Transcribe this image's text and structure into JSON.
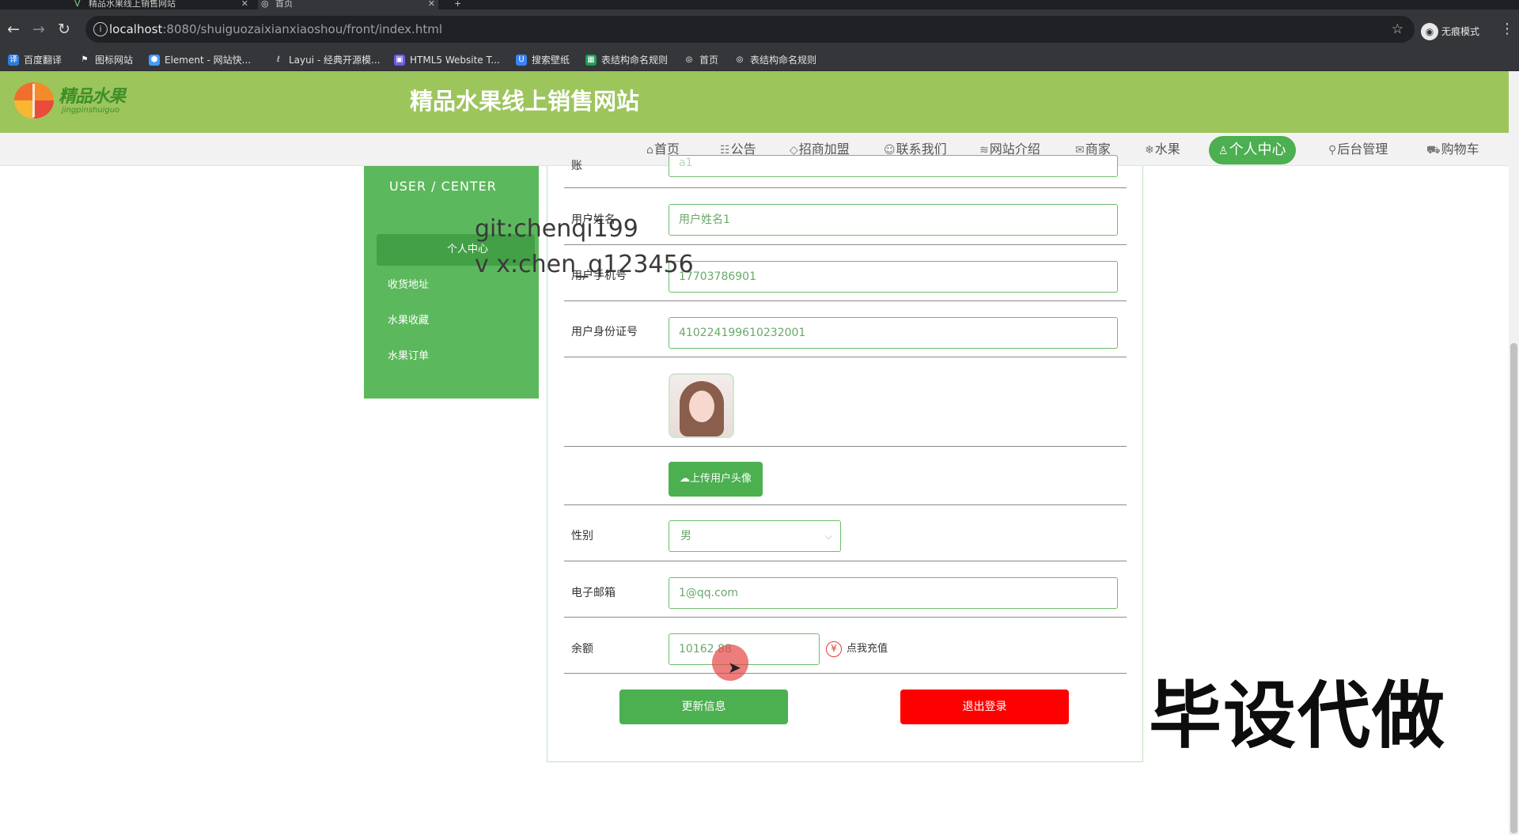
{
  "browser": {
    "tabs": [
      {
        "title": "精品水果线上销售网站",
        "active": false
      },
      {
        "title": "首页",
        "active": true
      }
    ],
    "new_tab_symbol": "+",
    "url_host": "localhost",
    "url_rest": ":8080/shuiguozaixianxiaoshou/front/index.html",
    "incognito_label": "无痕模式",
    "bookmarks": [
      "百度翻译",
      "图标网站",
      "Element - 网站快...",
      "Layui - 经典开源模...",
      "HTML5 Website T...",
      "搜索壁纸",
      "表结构命名规则",
      "首页",
      "表结构命名规则"
    ]
  },
  "site": {
    "logo_text": "精品水果",
    "logo_subtext": "jingpinshuiguo",
    "title": "精品水果线上销售网站",
    "nav": [
      {
        "label": "首页",
        "icon": "home-icon",
        "glyph": "⌂"
      },
      {
        "label": "公告",
        "icon": "notice-icon",
        "glyph": "☷"
      },
      {
        "label": "招商加盟",
        "icon": "tag-icon",
        "glyph": "◇"
      },
      {
        "label": "联系我们",
        "icon": "contact-icon",
        "glyph": "☺"
      },
      {
        "label": "网站介绍",
        "icon": "book-icon",
        "glyph": "≋"
      },
      {
        "label": "商家",
        "icon": "mail-icon",
        "glyph": "✉"
      },
      {
        "label": "水果",
        "icon": "snowflake-icon",
        "glyph": "❄"
      },
      {
        "label": "个人中心",
        "icon": "user-icon",
        "glyph": "♙",
        "active": true
      },
      {
        "label": "后台管理",
        "icon": "link-icon",
        "glyph": "⚲"
      },
      {
        "label": "购物车",
        "icon": "cart-icon",
        "glyph": "⛟"
      }
    ]
  },
  "sidebar": {
    "heading": "USER / CENTER",
    "items": [
      {
        "label": "个人中心",
        "active": true
      },
      {
        "label": "收货地址"
      },
      {
        "label": "水果收藏"
      },
      {
        "label": "水果订单"
      }
    ]
  },
  "form": {
    "top_cut_label": "账",
    "top_cut_value": "a1",
    "name_label": "用户姓名",
    "name_value": "用户姓名1",
    "phone_label": "用户手机号",
    "phone_value": "17703786901",
    "idcard_label": "用户身份证号",
    "idcard_value": "410224199610232001",
    "upload_label": "上传用户头像",
    "gender_label": "性别",
    "gender_value": "男",
    "email_label": "电子邮箱",
    "email_value": "1@qq.com",
    "balance_label": "余额",
    "balance_value": "10162.88",
    "recharge_label": "点我充值",
    "update_label": "更新信息",
    "logout_label": "退出登录"
  },
  "watermarks": {
    "git": "git:chenqi199",
    "vx": "v x:chen_q123456",
    "big": "毕设代做"
  },
  "colors": {
    "header_green": "#9cc55c",
    "accent_green": "#4caf50",
    "danger_red": "#ff0000"
  }
}
